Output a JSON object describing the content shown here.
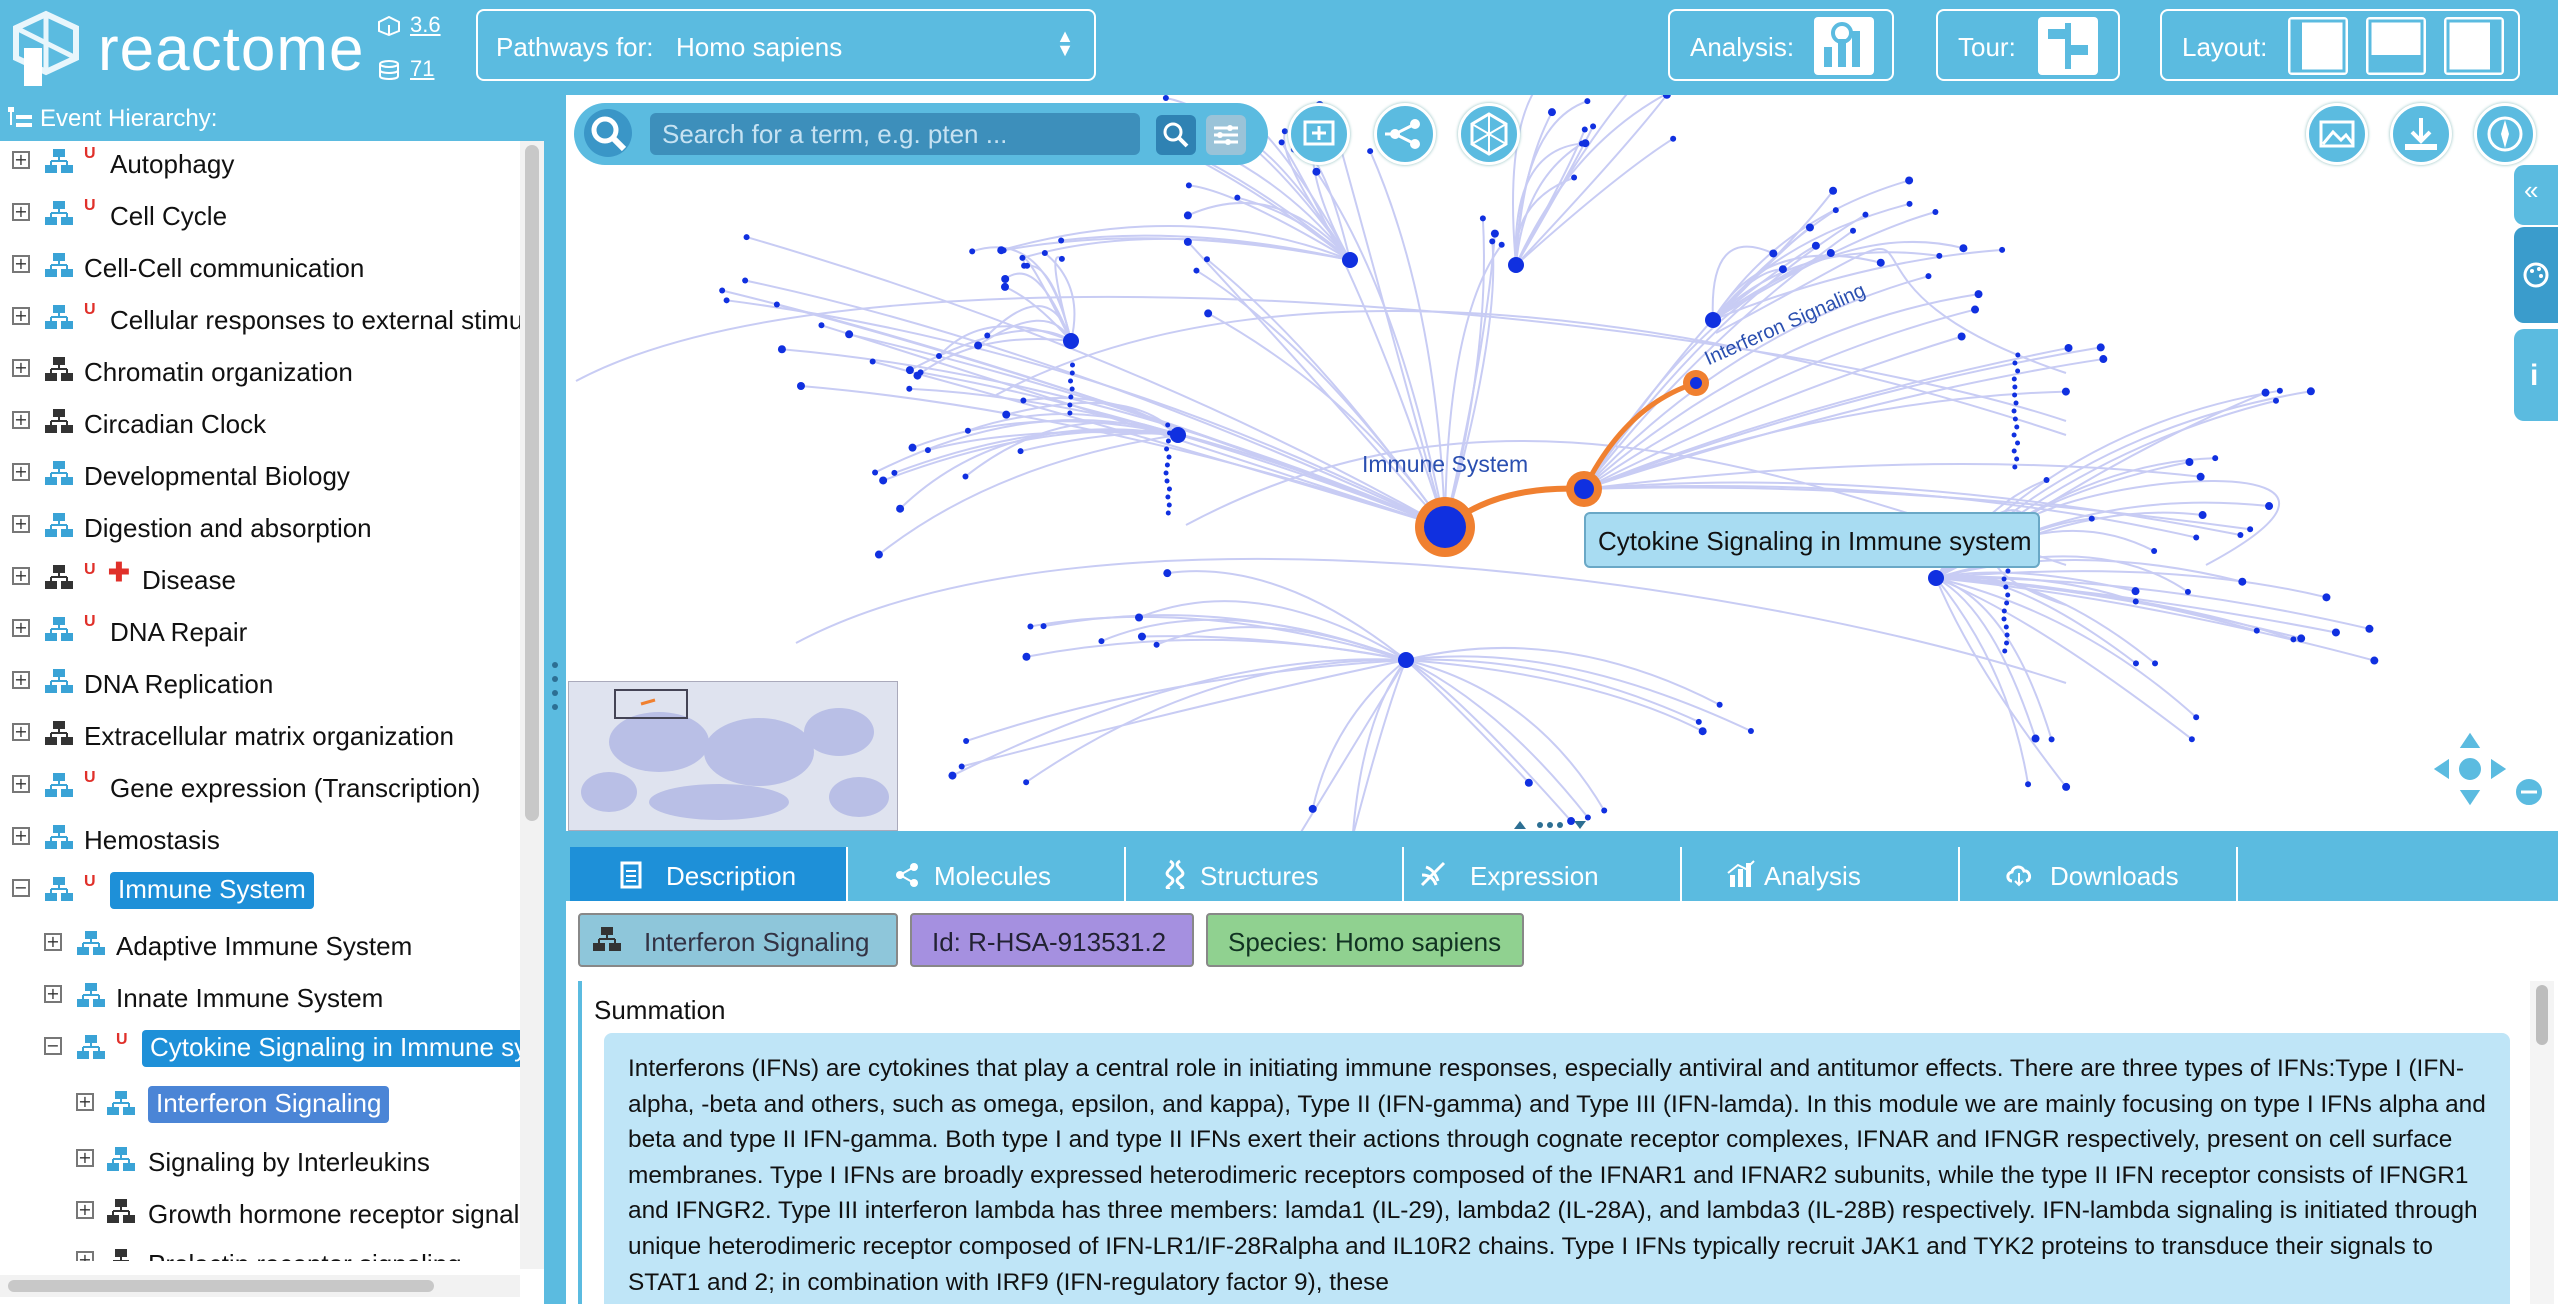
{
  "header": {
    "logo_text": "reactome",
    "release_version": "3.6",
    "db_version": "71",
    "species_label": "Pathways for:",
    "species_value": "Homo sapiens",
    "analysis_label": "Analysis:",
    "tour_label": "Tour:",
    "layout_label": "Layout:"
  },
  "event_hierarchy": {
    "title": "Event Hierarchy:",
    "items": [
      {
        "label": "Autophagy"
      },
      {
        "label": "Cell Cycle"
      },
      {
        "label": "Cell-Cell communication"
      },
      {
        "label": "Cellular responses to external stimu"
      },
      {
        "label": "Chromatin organization"
      },
      {
        "label": "Circadian Clock"
      },
      {
        "label": "Developmental Biology"
      },
      {
        "label": "Digestion and absorption"
      },
      {
        "label": "Disease"
      },
      {
        "label": "DNA Repair"
      },
      {
        "label": "DNA Replication"
      },
      {
        "label": "Extracellular matrix organization"
      },
      {
        "label": "Gene expression (Transcription)"
      },
      {
        "label": "Hemostasis"
      },
      {
        "label": "Immune System"
      },
      {
        "label": "Adaptive Immune System"
      },
      {
        "label": "Innate Immune System"
      },
      {
        "label": "Cytokine Signaling in Immune sy"
      },
      {
        "label": "Interferon Signaling"
      },
      {
        "label": "Signaling by Interleukins"
      },
      {
        "label": "Growth hormone receptor signal"
      },
      {
        "label": "Prolactin receptor signaling"
      }
    ]
  },
  "search": {
    "placeholder": "Search for a term, e.g. pten ..."
  },
  "diagram": {
    "node_labels": {
      "immune_system": "Immune System",
      "interferon_signaling": "Interferon Signaling"
    },
    "tooltip": "Cytokine Signaling in Immune system"
  },
  "details": {
    "tabs": [
      {
        "label": "Description"
      },
      {
        "label": "Molecules"
      },
      {
        "label": "Structures"
      },
      {
        "label": "Expression"
      },
      {
        "label": "Analysis"
      },
      {
        "label": "Downloads"
      }
    ],
    "chips": {
      "name": "Interferon Signaling",
      "id": "Id: R-HSA-913531.2",
      "species": "Species: Homo sapiens"
    },
    "summation_title": "Summation",
    "summation_text": "Interferons (IFNs) are cytokines that play a central role in initiating immune responses, especially antiviral and antitumor effects. There are three types of IFNs:Type I (IFN-alpha, -beta and others, such as omega, epsilon, and kappa), Type II (IFN-gamma) and Type III (IFN-lamda). In this module we are mainly focusing on type I IFNs alpha and beta and type II IFN-gamma. Both type I and type II IFNs exert their actions through cognate receptor complexes, IFNAR and IFNGR respectively, present on cell surface membranes. Type I IFNs are broadly expressed heterodimeric receptors composed of the IFNAR1 and IFNAR2 subunits, while the type II IFN receptor consists of IFNGR1 and IFNGR2. Type III interferon lambda has three members: lamda1 (IL-29), lambda2 (IL-28A), and lambda3 (IL-28B) respectively. IFN-lambda signaling is initiated through unique heterodimeric receptor composed of IFN-LR1/IF-28Ralpha and IL10R2 chains. Type I IFNs typically recruit JAK1 and TYK2 proteins to transduce their signals to STAT1 and 2; in combination with IRF9 (IFN-regulatory factor 9), these"
  },
  "colors": {
    "header_bg": "#5bbbe0",
    "selected_bg": "#1e90d8",
    "highlight_orange": "#f08030",
    "node_blue": "#1030e0",
    "edge": "#c8ccf4"
  }
}
